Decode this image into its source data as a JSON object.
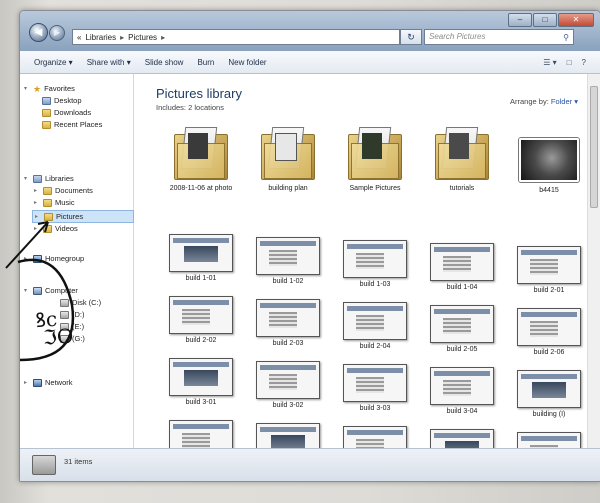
{
  "window": {
    "address_root": "«",
    "address_crumbs": [
      "Libraries",
      "Pictures"
    ],
    "search_placeholder": "Search Pictures",
    "controls": [
      "–",
      "□",
      "✕"
    ]
  },
  "toolbar": {
    "items": [
      "Organize ▾",
      "Share with ▾",
      "Slide show",
      "Burn",
      "New folder"
    ],
    "right": [
      "☰ ▾",
      "□",
      "?"
    ]
  },
  "nav": {
    "favorites": "Favorites",
    "desktop": "Desktop",
    "downloads": "Downloads",
    "recent": "Recent Places",
    "libraries": "Libraries",
    "documents": "Documents",
    "music": "Music",
    "pictures": "Pictures",
    "videos": "Videos",
    "homegroup": "Homegroup",
    "computer": "Computer",
    "disk_c": "Disk (C:)",
    "disk_d": "(D:)",
    "disk_e": "(E:)",
    "disk_g": "(G:)",
    "network": "Network"
  },
  "content": {
    "title": "Pictures library",
    "subtitle": "Includes:  2 locations",
    "arrange_label": "Arrange by:",
    "arrange_value": "Folder ▾",
    "folders": [
      "2008-11-06 at photo",
      "building plan",
      "Sample Pictures",
      "tutorials",
      "b4415"
    ],
    "screens_row1": [
      "build 1-01",
      "build 1-02",
      "build 1-03",
      "build 1-04",
      "build 2-01"
    ],
    "screens_row2": [
      "build 2-02",
      "build 2-03",
      "build 2-04",
      "build 2-05",
      "build 2-06"
    ],
    "screens_row3": [
      "build 3-01",
      "build 3-02",
      "build 3-03",
      "build 3-04",
      "building (I)"
    ]
  },
  "status": {
    "text": "31 items"
  },
  "annotation": {
    "handwritten": "ꝸc\n ℑO"
  }
}
